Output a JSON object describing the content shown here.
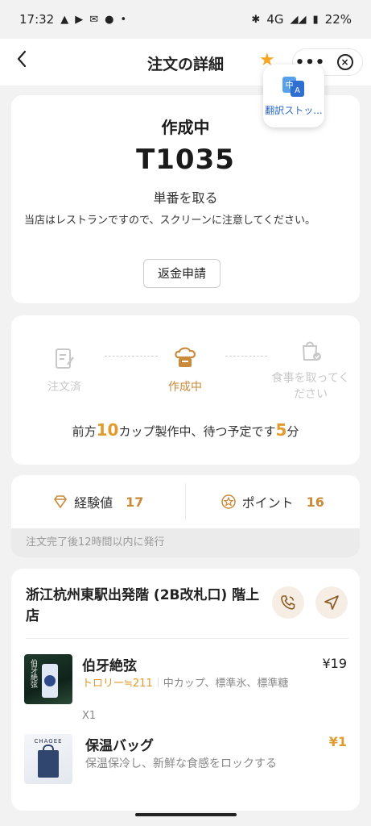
{
  "status_bar": {
    "time": "17:32",
    "network": "4G",
    "battery": "22%"
  },
  "nav": {
    "title": "注文の詳細",
    "capsule_more": "•••"
  },
  "translate_popup": {
    "label": "翻訳ストッ..."
  },
  "order_status": {
    "status": "作成中",
    "order_number": "T1035",
    "take_number_label": "単番を取る",
    "notice": "当店はレストランですので、スクリーンに注意してください。",
    "refund_button": "返金申請"
  },
  "progress": {
    "steps": [
      {
        "label": "注文済"
      },
      {
        "label": "作成中"
      },
      {
        "label": "食事を取ってください"
      }
    ],
    "queue": {
      "prefix": "前方",
      "cups": "10",
      "middle": "カップ製作中、待つ予定です",
      "minutes": "5",
      "suffix": "分"
    }
  },
  "rewards": {
    "experience_label": "経験値",
    "experience_value": "17",
    "points_label": "ポイント",
    "points_value": "16",
    "note": "注文完了後12時間以内に発行"
  },
  "store": {
    "name": "浙江杭州東駅出発階 (2B改札口) 階上店"
  },
  "items": [
    {
      "name": "伯牙絶弦",
      "price": "¥19",
      "tag": "トロリー≒211",
      "options": "中カップ、標準氷、標準糖",
      "quantity": "X1",
      "thumb_text": "伯牙絶弦"
    },
    {
      "name": "保温バッグ",
      "price": "¥1",
      "description": "保温保冷し、新鮮な食感をロックする",
      "thumb_text": "CHAGEE"
    }
  ],
  "colors": {
    "accent": "#c98a3a",
    "highlight": "#e39a2c",
    "star": "#f5a623",
    "link_blue": "#2a66c9"
  }
}
